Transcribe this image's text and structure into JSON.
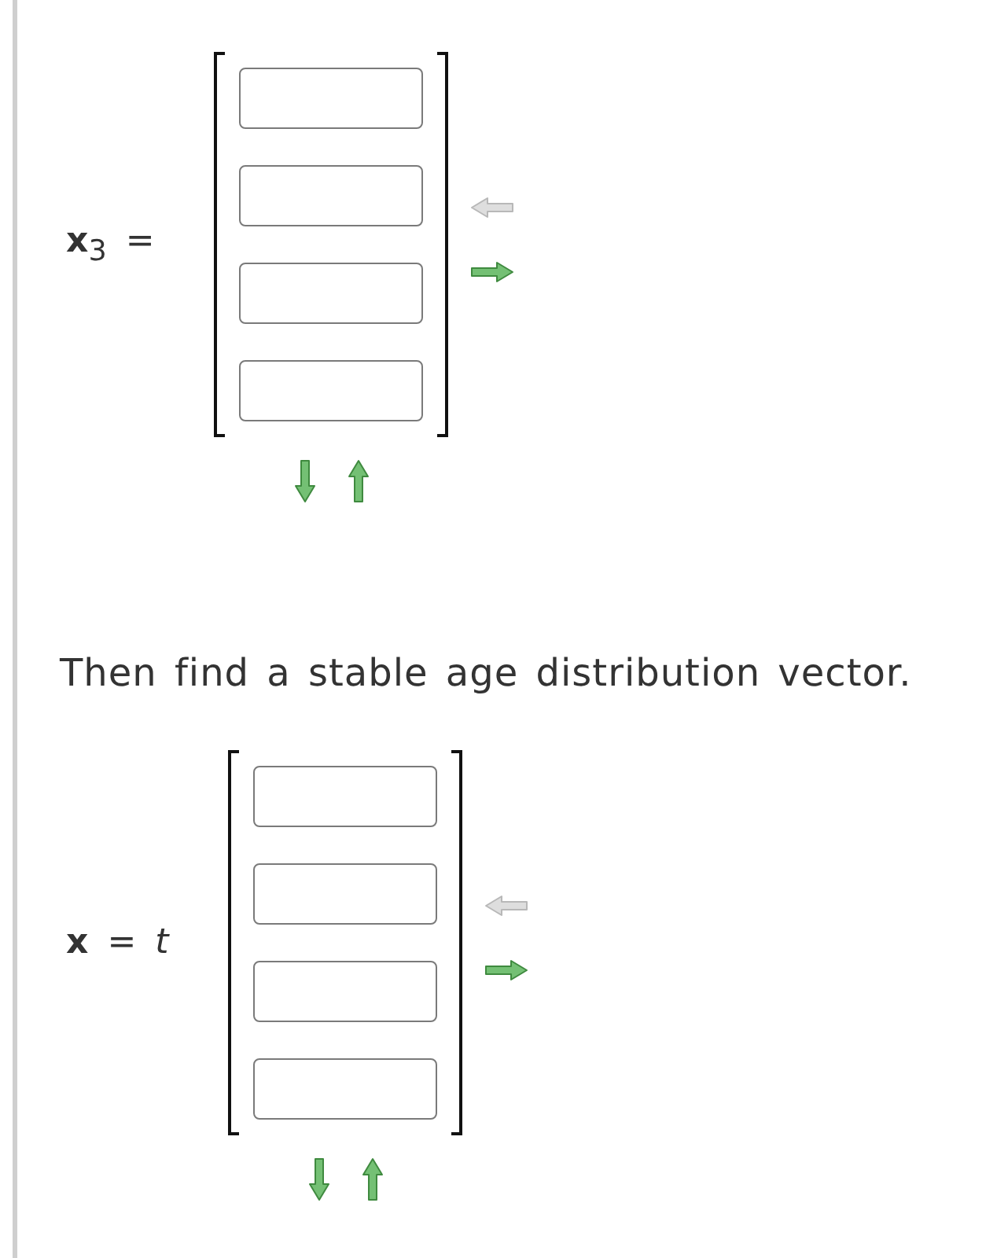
{
  "sections": [
    {
      "kind": "matrix",
      "label": "**x**$_{3}$ =",
      "entries": [
        {
          "kind": "input"
        },
        {
          "kind": "input"
        },
        {
          "kind": "input"
        },
        {
          "kind": "input"
        }
      ],
      "side_arrows": [
        {
          "kind": "left",
          "disabled": true
        },
        {
          "kind": "right",
          "disabled": false
        }
      ],
      "bottom_arrows": [
        {
          "kind": "down",
          "disabled": false
        },
        {
          "kind": "up",
          "disabled": false
        }
      ]
    },
    {
      "kind": "prompt",
      "text": "Then find a stable age distribution vector."
    },
    {
      "kind": "matrix",
      "label": "**x** = *t*",
      "entries": [
        {
          "kind": "input"
        },
        {
          "kind": "input"
        },
        {
          "kind": "input"
        },
        {
          "kind": "input"
        }
      ],
      "side_arrows": [
        {
          "kind": "left",
          "disabled": true
        },
        {
          "kind": "right",
          "disabled": false
        }
      ],
      "bottom_arrows": [
        {
          "kind": "down",
          "disabled": false
        },
        {
          "kind": "up",
          "disabled": false
        }
      ]
    }
  ]
}
